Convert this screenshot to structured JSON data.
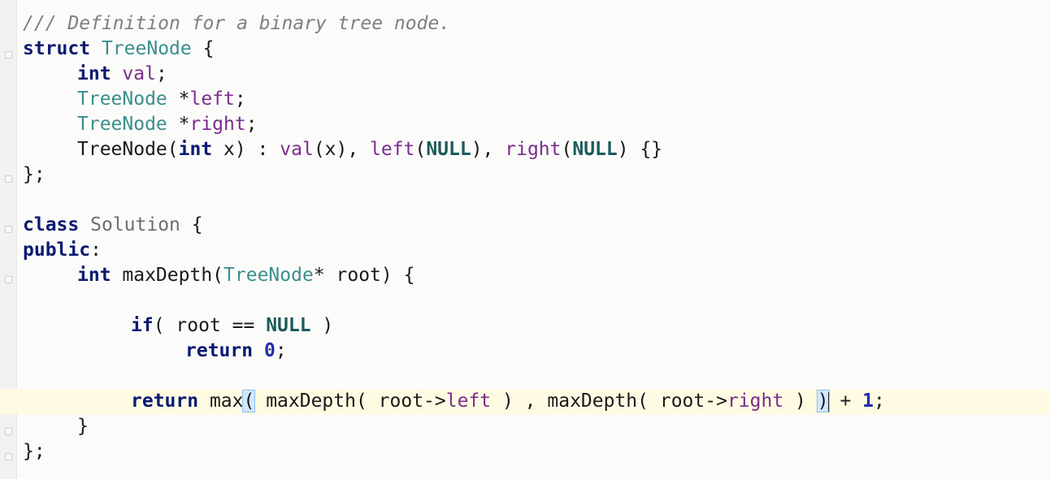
{
  "editor": {
    "lines": [
      {
        "tokens": [
          {
            "t": "/// Definition for a binary tree node.",
            "c": "cmt"
          }
        ]
      },
      {
        "tokens": [
          {
            "t": "struct",
            "c": "kw"
          },
          {
            "t": " "
          },
          {
            "t": "TreeNode",
            "c": "type"
          },
          {
            "t": " {"
          }
        ]
      },
      {
        "indent": 1,
        "tokens": [
          {
            "t": "int",
            "c": "kw"
          },
          {
            "t": " "
          },
          {
            "t": "val",
            "c": "fld"
          },
          {
            "t": ";"
          }
        ]
      },
      {
        "indent": 1,
        "tokens": [
          {
            "t": "TreeNode",
            "c": "type"
          },
          {
            "t": " *"
          },
          {
            "t": "left",
            "c": "fld"
          },
          {
            "t": ";"
          }
        ]
      },
      {
        "indent": 1,
        "tokens": [
          {
            "t": "TreeNode",
            "c": "type"
          },
          {
            "t": " *"
          },
          {
            "t": "right",
            "c": "fld"
          },
          {
            "t": ";"
          }
        ]
      },
      {
        "indent": 1,
        "tokens": [
          {
            "t": "TreeNode("
          },
          {
            "t": "int",
            "c": "kw"
          },
          {
            "t": " x) : "
          },
          {
            "t": "val",
            "c": "fld"
          },
          {
            "t": "(x), "
          },
          {
            "t": "left",
            "c": "fld"
          },
          {
            "t": "("
          },
          {
            "t": "NULL",
            "c": "lit"
          },
          {
            "t": "), "
          },
          {
            "t": "right",
            "c": "fld"
          },
          {
            "t": "("
          },
          {
            "t": "NULL",
            "c": "lit"
          },
          {
            "t": ") {}"
          }
        ]
      },
      {
        "tokens": [
          {
            "t": "};"
          }
        ]
      },
      {
        "tokens": [
          {
            "t": ""
          }
        ]
      },
      {
        "tokens": [
          {
            "t": "class",
            "c": "kw"
          },
          {
            "t": " "
          },
          {
            "t": "Solution",
            "c": "cls"
          },
          {
            "t": " {"
          }
        ]
      },
      {
        "tokens": [
          {
            "t": "public",
            "c": "kw"
          },
          {
            "t": ":"
          }
        ]
      },
      {
        "indent": 1,
        "tokens": [
          {
            "t": "int",
            "c": "kw"
          },
          {
            "t": " maxDepth("
          },
          {
            "t": "TreeNode",
            "c": "type"
          },
          {
            "t": "* root) {"
          }
        ]
      },
      {
        "tokens": [
          {
            "t": ""
          }
        ]
      },
      {
        "indent": 2,
        "tokens": [
          {
            "t": "if",
            "c": "kw"
          },
          {
            "t": "( root == "
          },
          {
            "t": "NULL",
            "c": "lit"
          },
          {
            "t": " )"
          }
        ]
      },
      {
        "indent": 3,
        "tokens": [
          {
            "t": "return",
            "c": "kw"
          },
          {
            "t": " "
          },
          {
            "t": "0",
            "c": "num"
          },
          {
            "t": ";"
          }
        ]
      },
      {
        "tokens": [
          {
            "t": ""
          }
        ]
      },
      {
        "indent": 2,
        "current": true,
        "tokens": [
          {
            "t": "return",
            "c": "kw"
          },
          {
            "t": " max"
          },
          {
            "t": "(",
            "c": "brkt"
          },
          {
            "t": " maxDepth( root->"
          },
          {
            "t": "left",
            "c": "fld"
          },
          {
            "t": " ) , maxDepth( root->"
          },
          {
            "t": "right",
            "c": "fld"
          },
          {
            "t": " ) "
          },
          {
            "t": ")",
            "c": "brkt"
          },
          {
            "caret": true
          },
          {
            "t": " + "
          },
          {
            "t": "1",
            "c": "num"
          },
          {
            "t": ";"
          }
        ]
      },
      {
        "indent": 1,
        "tokens": [
          {
            "t": "}"
          }
        ]
      },
      {
        "tokens": [
          {
            "t": "};"
          }
        ]
      }
    ]
  }
}
